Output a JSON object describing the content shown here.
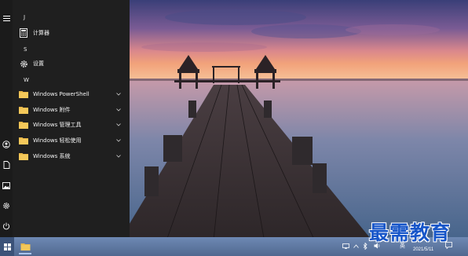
{
  "start_menu": {
    "groups": [
      {
        "letter": "J",
        "items": [
          {
            "label": "计算器",
            "icon": "calculator-icon"
          }
        ]
      },
      {
        "letter": "S",
        "items": [
          {
            "label": "设置",
            "icon": "gear-icon"
          }
        ]
      },
      {
        "letter": "W",
        "items": [
          {
            "label": "Windows PowerShell",
            "icon": "folder-icon",
            "expandable": true
          },
          {
            "label": "Windows 附件",
            "icon": "folder-icon",
            "expandable": true
          },
          {
            "label": "Windows 管理工具",
            "icon": "folder-icon",
            "expandable": true
          },
          {
            "label": "Windows 轻松使用",
            "icon": "folder-icon",
            "expandable": true
          },
          {
            "label": "Windows 系统",
            "icon": "folder-icon",
            "expandable": true
          }
        ]
      }
    ],
    "rail": [
      "hamburger-icon",
      "user-icon",
      "document-icon",
      "pictures-icon",
      "gear-icon",
      "power-icon"
    ]
  },
  "taskbar": {
    "ime_label": "英",
    "date": "2021/5/11",
    "tray_icons": [
      "network-icon",
      "volume-icon",
      "bluetooth-icon",
      "chevron-up-icon"
    ]
  },
  "watermark": {
    "text": "最需教育"
  },
  "colors": {
    "menu_bg": "#1f1f1f",
    "folder": "#e9b84a",
    "taskbar": "#5f7aa6",
    "watermark": "#1756c9"
  }
}
